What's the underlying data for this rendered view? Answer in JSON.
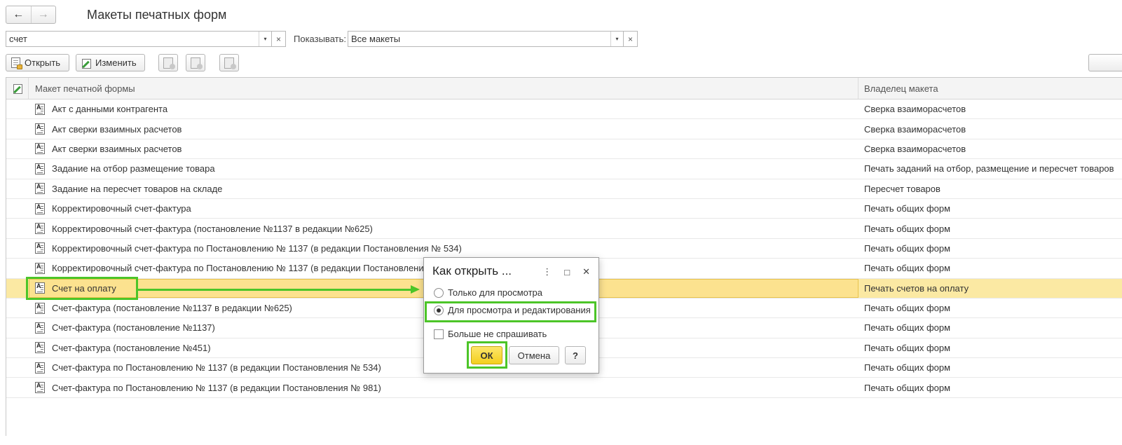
{
  "header": {
    "title": "Макеты печатных форм",
    "back_icon": "←",
    "forward_icon": "→"
  },
  "filters": {
    "search_value": "счет",
    "show_label": "Показывать:",
    "show_value": "Все макеты",
    "clear_icon": "×",
    "dropdown_icon": "▾"
  },
  "toolbar": {
    "open_label": "Открыть",
    "edit_label": "Изменить"
  },
  "table": {
    "headers": {
      "template": "Макет печатной формы",
      "owner": "Владелец макета"
    },
    "rows": [
      {
        "name": "Акт с данными контрагента",
        "owner": "Сверка взаиморасчетов"
      },
      {
        "name": "Акт сверки взаимных расчетов",
        "owner": "Сверка взаиморасчетов"
      },
      {
        "name": "Акт сверки взаимных расчетов",
        "owner": "Сверка взаиморасчетов"
      },
      {
        "name": "Задание на отбор размещение товара",
        "owner": "Печать заданий на отбор, размещение и пересчет товаров"
      },
      {
        "name": "Задание на пересчет товаров на складе",
        "owner": "Пересчет товаров"
      },
      {
        "name": "Корректировочный счет-фактура",
        "owner": "Печать общих форм"
      },
      {
        "name": "Корректировочный счет-фактура (постановление №1137 в редакции №625)",
        "owner": "Печать общих форм"
      },
      {
        "name": "Корректировочный счет-фактура по Постановлению № 1137 (в редакции Постановления № 534)",
        "owner": "Печать общих форм"
      },
      {
        "name": "Корректировочный счет-фактура по Постановлению № 1137 (в редакции Постановления № 981)",
        "owner": "Печать общих форм"
      },
      {
        "name": "Счет на оплату",
        "owner": "Печать счетов на оплату"
      },
      {
        "name": "Счет-фактура (постановление №1137 в редакции №625)",
        "owner": "Печать общих форм"
      },
      {
        "name": "Счет-фактура (постановление №1137)",
        "owner": "Печать общих форм"
      },
      {
        "name": "Счет-фактура (постановление №451)",
        "owner": "Печать общих форм"
      },
      {
        "name": "Счет-фактура по Постановлению № 1137 (в редакции Постановления № 534)",
        "owner": "Печать общих форм"
      },
      {
        "name": "Счет-фактура по Постановлению № 1137 (в редакции Постановления № 981)",
        "owner": "Печать общих форм"
      }
    ]
  },
  "dialog": {
    "title": "Как открыть ...",
    "menu_icon": "⋮",
    "maximize_icon": "□",
    "close_icon": "✕",
    "option_view_only": "Только для просмотра",
    "option_view_edit": "Для просмотра и редактирования",
    "dont_ask": "Больше не спрашивать",
    "ok_label": "ОК",
    "cancel_label": "Отмена",
    "help_label": "?"
  },
  "colors": {
    "highlight_green": "#4cc528",
    "selected_row": "#fce28f",
    "ok_button": "#f3cf1d"
  }
}
